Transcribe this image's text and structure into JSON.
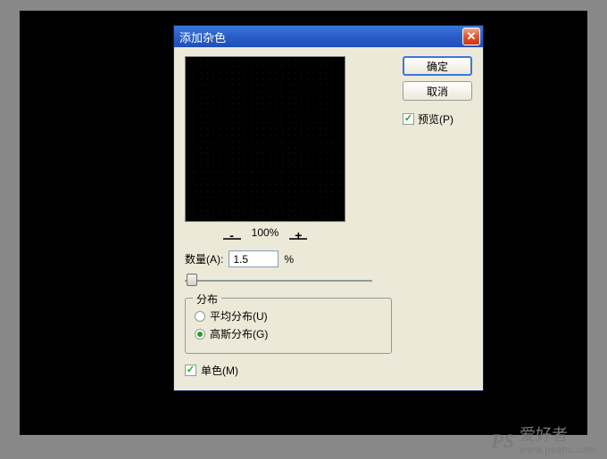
{
  "dialog": {
    "title": "添加杂色",
    "buttons": {
      "ok": "确定",
      "cancel": "取消"
    },
    "preview_label": "预览(P)",
    "zoom": {
      "minus": "-",
      "percent": "100%",
      "plus": "+"
    },
    "amount": {
      "label": "数量(A):",
      "value": "1.5",
      "unit": "%"
    },
    "distribution": {
      "legend": "分布",
      "uniform": "平均分布(U)",
      "gaussian": "高斯分布(G)",
      "selected": "gaussian"
    },
    "monochromatic": "单色(M)"
  },
  "watermark": {
    "ps": "PS",
    "cn": "爱好者",
    "url": "www.psahz.com"
  }
}
